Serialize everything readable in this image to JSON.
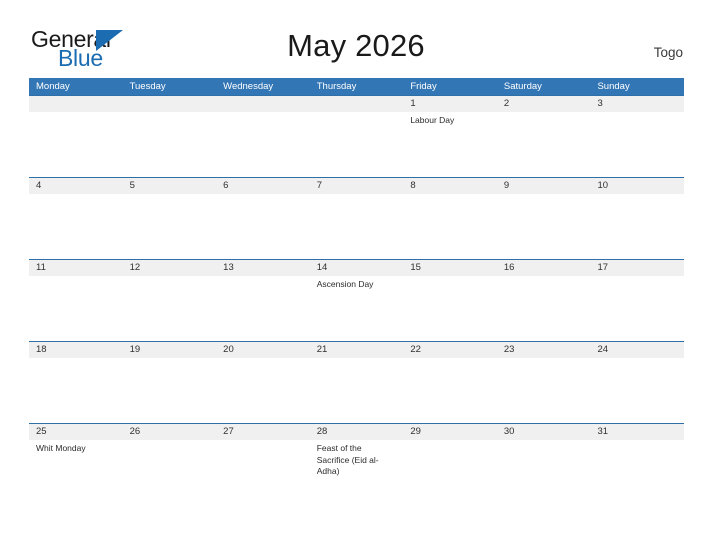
{
  "brand": {
    "name_part1": "General",
    "name_part2": "Blue",
    "triangle_icon": "triangle-icon",
    "accent_color": "#1b6cb0"
  },
  "header": {
    "title": "May 2026",
    "country": "Togo"
  },
  "theme": {
    "header_blue": "#3376b5",
    "row_band": "#f0f0f0",
    "row_border": "#2f6fa8",
    "text": "#222222"
  },
  "calendar": {
    "month": "May",
    "year": "2026",
    "weekdays": [
      "Monday",
      "Tuesday",
      "Wednesday",
      "Thursday",
      "Friday",
      "Saturday",
      "Sunday"
    ],
    "weeks": [
      {
        "dates": [
          "",
          "",
          "",
          "",
          "1",
          "2",
          "3"
        ],
        "events": [
          "",
          "",
          "",
          "",
          "Labour Day",
          "",
          ""
        ]
      },
      {
        "dates": [
          "4",
          "5",
          "6",
          "7",
          "8",
          "9",
          "10"
        ],
        "events": [
          "",
          "",
          "",
          "",
          "",
          "",
          ""
        ]
      },
      {
        "dates": [
          "11",
          "12",
          "13",
          "14",
          "15",
          "16",
          "17"
        ],
        "events": [
          "",
          "",
          "",
          "Ascension Day",
          "",
          "",
          ""
        ]
      },
      {
        "dates": [
          "18",
          "19",
          "20",
          "21",
          "22",
          "23",
          "24"
        ],
        "events": [
          "",
          "",
          "",
          "",
          "",
          "",
          ""
        ]
      },
      {
        "dates": [
          "25",
          "26",
          "27",
          "28",
          "29",
          "30",
          "31"
        ],
        "events": [
          "Whit Monday",
          "",
          "",
          "Feast of the Sacrifice (Eid al-Adha)",
          "",
          "",
          ""
        ]
      }
    ]
  }
}
